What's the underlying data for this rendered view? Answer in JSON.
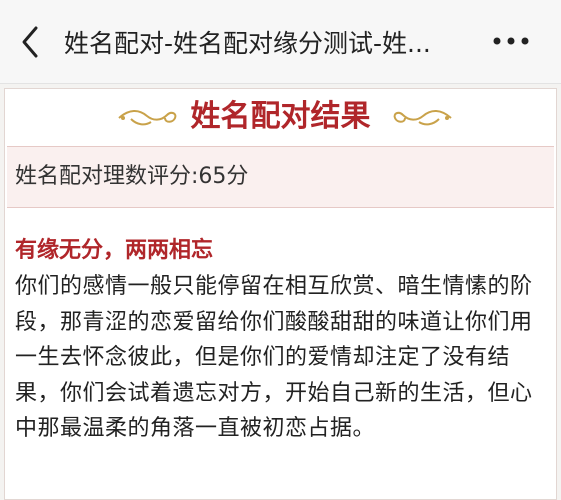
{
  "header": {
    "title": "姓名配对-姓名配对缘分测试-姓...",
    "back_icon": "back-chevron-icon",
    "more_icon": "more-dots-icon"
  },
  "result": {
    "heading": "姓名配对结果",
    "score_text": "姓名配对理数评分:65分",
    "subtitle": "有缘无分，两两相忘",
    "description": "你们的感情一般只能停留在相互欣赏、暗生情愫的阶段，那青涩的恋爱留给你们酸酸甜甜的味道让你们用一生去怀念彼此，但是你们的爱情却注定了没有结果，你们会试着遗忘对方，开始自己新的生活，但心中那最温柔的角落一直被初恋占据。"
  },
  "colors": {
    "accent": "#b0262a",
    "ornament": "#c9a24a",
    "score_bg": "#faf0ef"
  }
}
